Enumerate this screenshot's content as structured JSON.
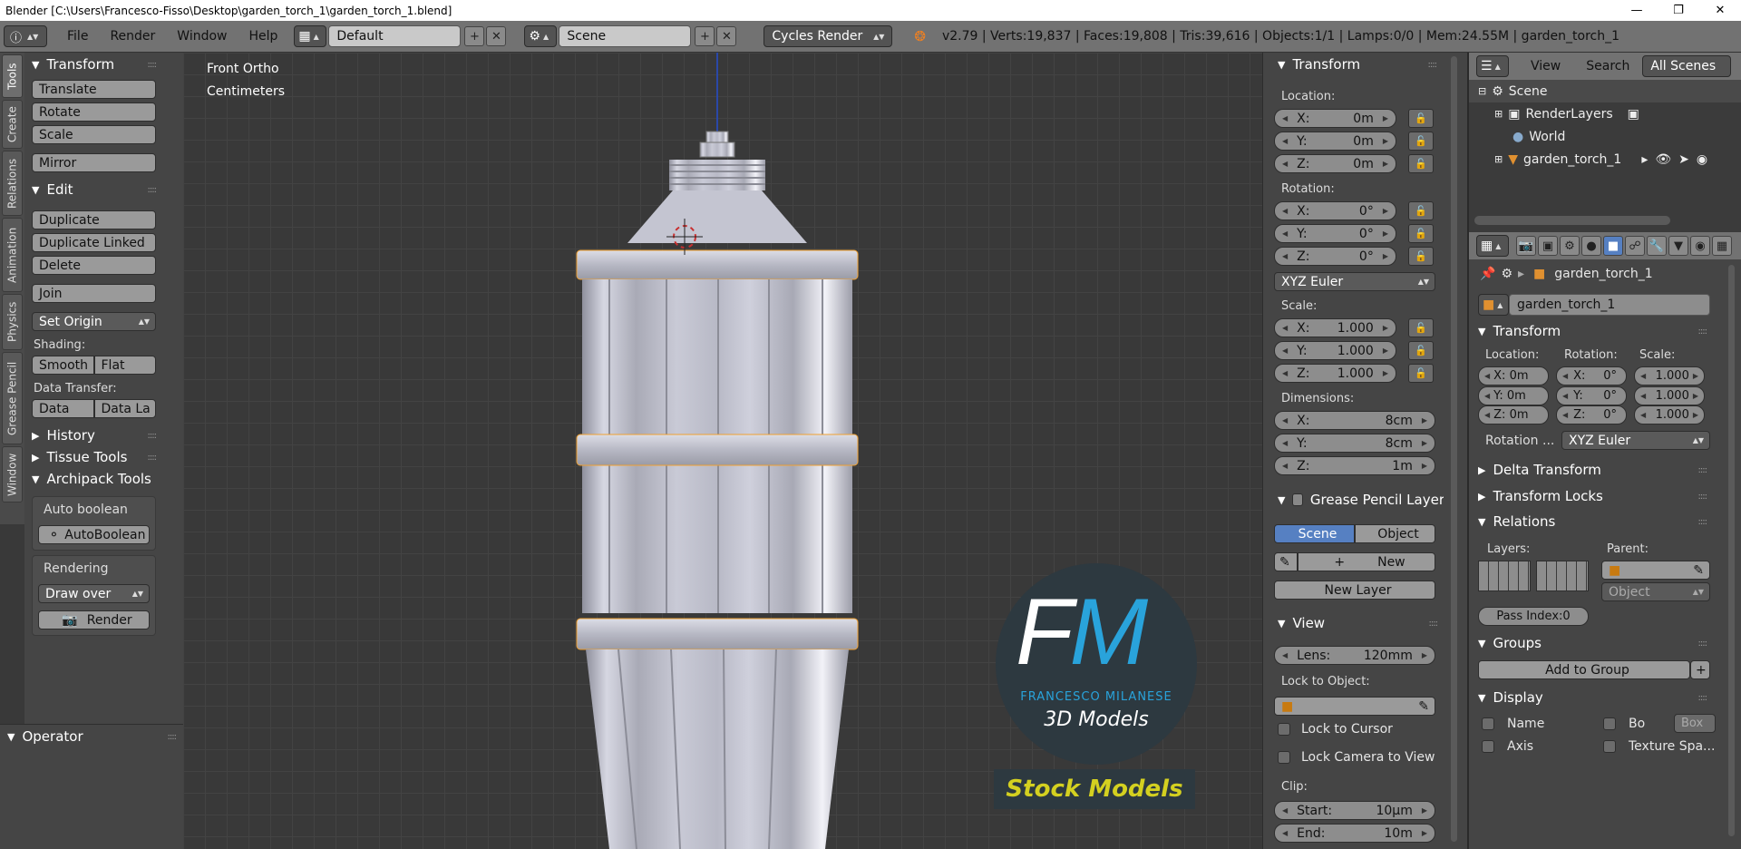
{
  "window": {
    "title": "Blender [C:\\Users\\Francesco-Fisso\\Desktop\\garden_torch_1\\garden_torch_1.blend]"
  },
  "info_header": {
    "menus": [
      "File",
      "Render",
      "Window",
      "Help"
    ],
    "screen_layout": "Default",
    "scene": "Scene",
    "render_engine": "Cycles Render",
    "stats": "v2.79 | Verts:19,837 | Faces:19,808 | Tris:39,616 | Objects:1/1 | Lamps:0/0 | Mem:24.55M | garden_torch_1"
  },
  "tool_tabs": [
    "Tools",
    "Create",
    "Relations",
    "Animation",
    "Physics",
    "Grease Pencil",
    "Window"
  ],
  "toolshelf": {
    "transform_title": "Transform",
    "translate": "Translate",
    "rotate": "Rotate",
    "scale": "Scale",
    "mirror": "Mirror",
    "edit_title": "Edit",
    "duplicate": "Duplicate",
    "duplicate_linked": "Duplicate Linked",
    "delete": "Delete",
    "join": "Join",
    "set_origin": "Set Origin",
    "shading_label": "Shading:",
    "smooth": "Smooth",
    "flat": "Flat",
    "data_transfer_label": "Data Transfer:",
    "data": "Data",
    "data_la": "Data La",
    "history": "History",
    "tissue_tools": "Tissue Tools",
    "archipack_tools": "Archipack Tools",
    "auto_boolean_label": "Auto boolean",
    "auto_boolean_btn": "AutoBoolean",
    "rendering_label": "Rendering",
    "draw_over": "Draw over",
    "render": "Render",
    "operator": "Operator"
  },
  "viewport": {
    "view_name": "Front Ortho",
    "units": "Centimeters",
    "watermark_letters": "FM",
    "watermark_name": "FRANCESCO MILANESE",
    "watermark_sub": "3D Models",
    "watermark_banner": "Stock Models"
  },
  "npanel": {
    "transform_title": "Transform",
    "location_label": "Location:",
    "loc": [
      {
        "axis": "X:",
        "value": "0m"
      },
      {
        "axis": "Y:",
        "value": "0m"
      },
      {
        "axis": "Z:",
        "value": "0m"
      }
    ],
    "rotation_label": "Rotation:",
    "rot": [
      {
        "axis": "X:",
        "value": "0°"
      },
      {
        "axis": "Y:",
        "value": "0°"
      },
      {
        "axis": "Z:",
        "value": "0°"
      }
    ],
    "rotation_mode": "XYZ Euler",
    "scale_label": "Scale:",
    "scl": [
      {
        "axis": "X:",
        "value": "1.000"
      },
      {
        "axis": "Y:",
        "value": "1.000"
      },
      {
        "axis": "Z:",
        "value": "1.000"
      }
    ],
    "dimensions_label": "Dimensions:",
    "dim": [
      {
        "axis": "X:",
        "value": "8cm"
      },
      {
        "axis": "Y:",
        "value": "8cm"
      },
      {
        "axis": "Z:",
        "value": "1m"
      }
    ],
    "grease_pencil_title": "Grease Pencil Layer",
    "gp_scene": "Scene",
    "gp_object": "Object",
    "gp_new": "New",
    "gp_new_layer": "New Layer",
    "view_title": "View",
    "lens_label": "Lens:",
    "lens_value": "120mm",
    "lock_to_object_label": "Lock to Object:",
    "lock_to_cursor": "Lock to Cursor",
    "lock_camera": "Lock Camera to View",
    "clip_label": "Clip:",
    "clip_start_label": "Start:",
    "clip_start": "10µm",
    "clip_end_label": "End:",
    "clip_end": "10m"
  },
  "outliner": {
    "view": "View",
    "search": "Search",
    "filter": "All Scenes",
    "items": [
      "Scene",
      "RenderLayers",
      "World",
      "garden_torch_1"
    ]
  },
  "properties": {
    "context_object": "garden_torch_1",
    "object_name": "garden_torch_1",
    "transform_title": "Transform",
    "location_label": "Location:",
    "rotation_label": "Rotation:",
    "scale_label": "Scale:",
    "loc": [
      "X: 0m",
      "Y: 0m",
      "Z: 0m"
    ],
    "rot_axes": [
      "X:",
      "Y:",
      "Z:"
    ],
    "rot_vals": [
      "0°",
      "0°",
      "0°"
    ],
    "scl": [
      "1.000",
      "1.000",
      "1.000"
    ],
    "rotation_mode_label": "Rotation ...",
    "rotation_mode": "XYZ Euler",
    "delta_transform": "Delta Transform",
    "transform_locks": "Transform Locks",
    "relations": "Relations",
    "layers_label": "Layers:",
    "parent_label": "Parent:",
    "parent_type": "Object",
    "pass_index": "Pass Index:0",
    "groups": "Groups",
    "add_to_group": "Add to Group",
    "display": "Display",
    "name": "Name",
    "bo": "Bo",
    "box": "Box",
    "axis": "Axis",
    "texture_space": "Texture Spa..."
  },
  "colors": {
    "accent_blue": "#5680c2",
    "brand_blue": "#29a3db",
    "banner_yellow": "#d4d020",
    "selection_orange": "#f0a030"
  }
}
